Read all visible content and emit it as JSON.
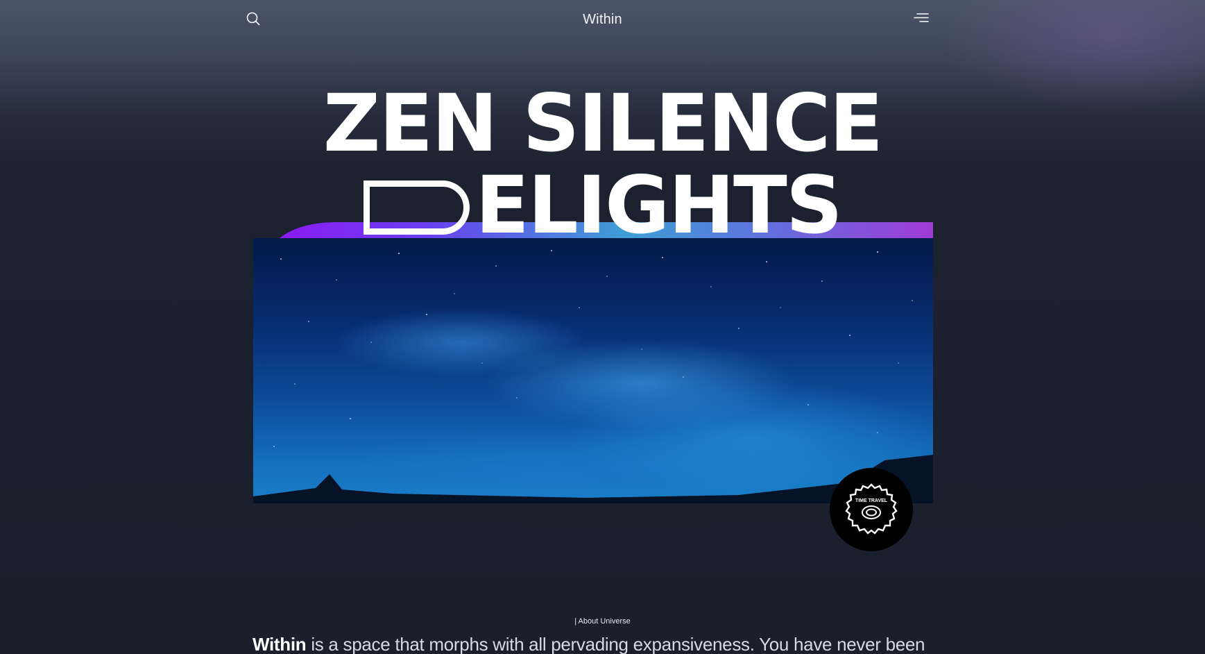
{
  "header": {
    "brand": "Within",
    "search_icon": "search-icon",
    "menu_icon": "menu-icon"
  },
  "hero": {
    "title_line1": "ZEN SILENCE",
    "title_line2_rest": "ELIGHTS",
    "image_alt": "starry night sky over mountains",
    "badge_text": "TIME TRAVEL"
  },
  "about": {
    "label": "| About Universe",
    "brand": "Within",
    "text": "is a space that morphs with all pervading expansiveness. You have never been"
  },
  "colors": {
    "accent_purple": "#8e1ff0",
    "accent_blue": "#3fa0d8",
    "background": "#1a1f2c"
  }
}
